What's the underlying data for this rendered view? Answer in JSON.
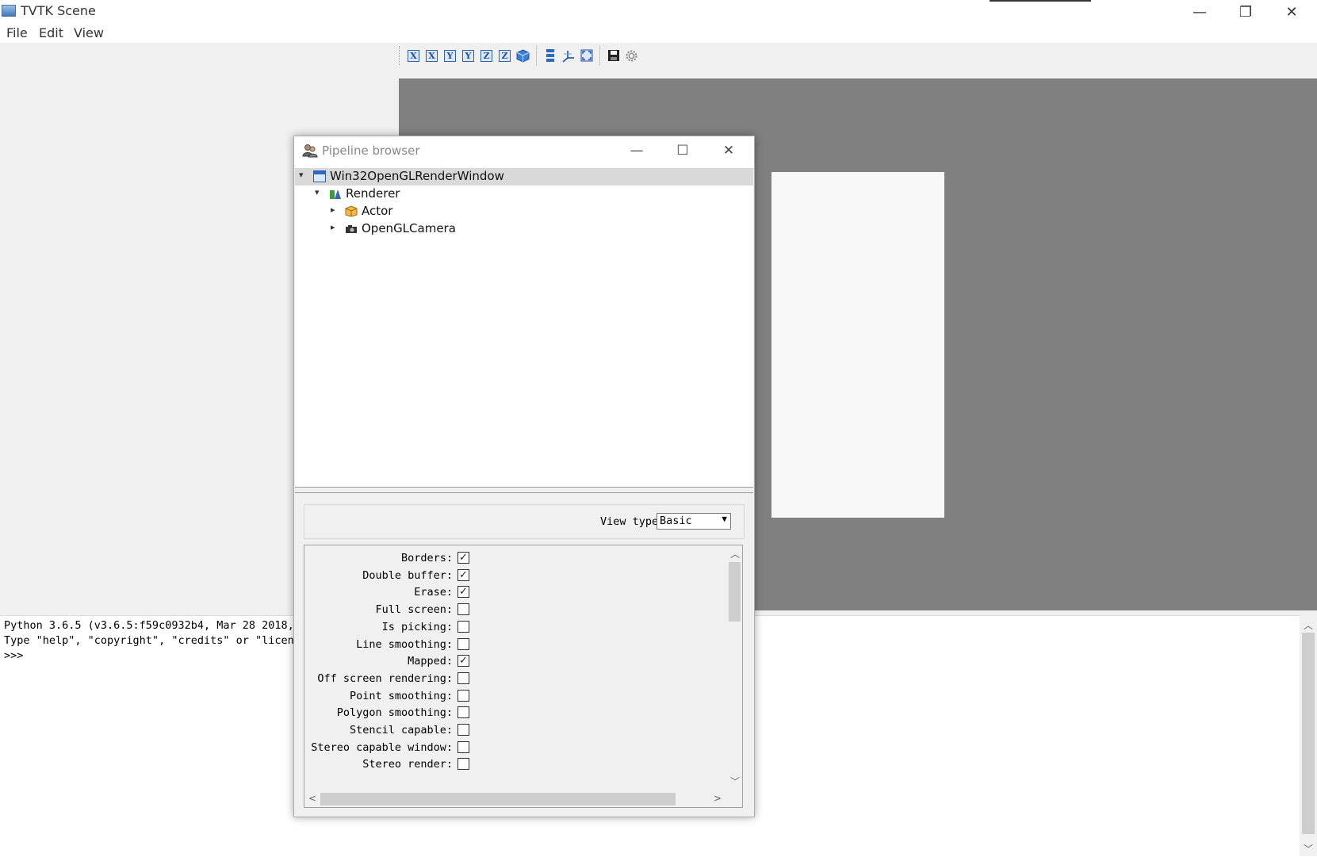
{
  "window": {
    "title": "TVTK Scene",
    "minimize_glyph": "—",
    "restore_glyph": "❐",
    "close_glyph": "✕"
  },
  "menu": [
    "File",
    "Edit",
    "View"
  ],
  "toolbar": {
    "axis_buttons": [
      "X",
      "X",
      "Y",
      "Y",
      "Z",
      "Z"
    ]
  },
  "shell": {
    "lines": [
      "Python 3.6.5 (v3.6.5:f59c0932b4, Mar 28 2018,",
      "Type \"help\", \"copyright\", \"credits\" or \"licens",
      ">>>"
    ]
  },
  "dialog": {
    "title": "Pipeline browser",
    "minimize_glyph": "—",
    "maximize_glyph": "☐",
    "close_glyph": "✕",
    "tree": [
      {
        "label": "Win32OpenGLRenderWindow",
        "expanded": true,
        "selected": true,
        "icon": "render-window-icon"
      },
      {
        "label": "Renderer",
        "expanded": true,
        "selected": false,
        "icon": "renderer-icon"
      },
      {
        "label": "Actor",
        "expanded": false,
        "selected": false,
        "icon": "actor-icon"
      },
      {
        "label": "OpenGLCamera",
        "expanded": false,
        "selected": false,
        "icon": "camera-icon"
      }
    ],
    "view_type": {
      "label": "View type:",
      "value": "Basic"
    },
    "properties": [
      {
        "label": "Borders:",
        "checked": true
      },
      {
        "label": "Double buffer:",
        "checked": true
      },
      {
        "label": "Erase:",
        "checked": true
      },
      {
        "label": "Full screen:",
        "checked": false
      },
      {
        "label": "Is picking:",
        "checked": false
      },
      {
        "label": "Line smoothing:",
        "checked": false
      },
      {
        "label": "Mapped:",
        "checked": true
      },
      {
        "label": "Off screen rendering:",
        "checked": false
      },
      {
        "label": "Point smoothing:",
        "checked": false
      },
      {
        "label": "Polygon smoothing:",
        "checked": false
      },
      {
        "label": "Stencil capable:",
        "checked": false
      },
      {
        "label": "Stereo capable window:",
        "checked": false
      },
      {
        "label": "Stereo render:",
        "checked": false
      }
    ]
  },
  "colors": {
    "viewport_bg": "#808080",
    "render_area": "#f8f8f8",
    "selection": "#d9d9d9"
  }
}
